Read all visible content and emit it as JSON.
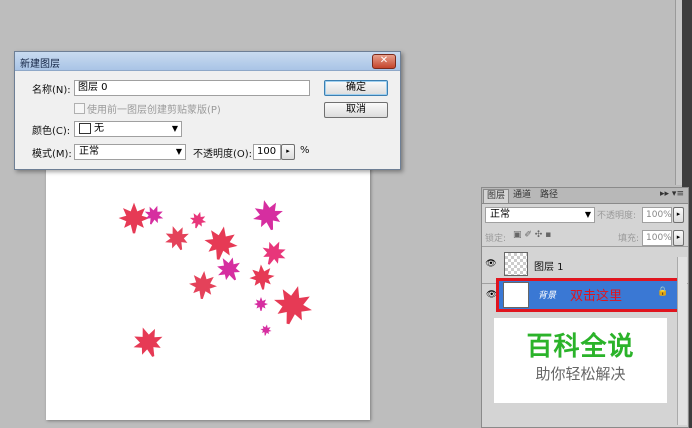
{
  "dialog": {
    "title": "新建图层",
    "close_icon": "close-icon",
    "name_label": "名称(N):",
    "name_value": "图层 0",
    "clip_checkbox_label": "使用前一图层创建剪贴蒙版(P)",
    "color_label": "颜色(C):",
    "color_value": "无",
    "mode_label": "模式(M):",
    "mode_value": "正常",
    "opacity_label": "不透明度(O):",
    "opacity_value": "100",
    "opacity_unit": "%",
    "ok_label": "确定",
    "cancel_label": "取消"
  },
  "canvas": {
    "leaf_colors": [
      "#e63a55",
      "#e8367a",
      "#d62ea0",
      "#e4425a"
    ]
  },
  "layers_panel": {
    "tabs": [
      "图层",
      "通道",
      "路径"
    ],
    "menu_icon": "panel-menu-icon",
    "blend_mode": "正常",
    "opacity_label": "不透明度:",
    "opacity_value": "100%",
    "lock_label": "锁定:",
    "fill_label": "填充:",
    "fill_value": "100%",
    "layers": [
      {
        "name": "图层 1",
        "visible": true
      },
      {
        "name": "背景",
        "visible": true,
        "locked": true
      }
    ]
  },
  "annotation": {
    "text": "双击这里",
    "color": "#e0141e"
  },
  "watermark": {
    "title": "百科全说",
    "subtitle": "助你轻松解决"
  }
}
